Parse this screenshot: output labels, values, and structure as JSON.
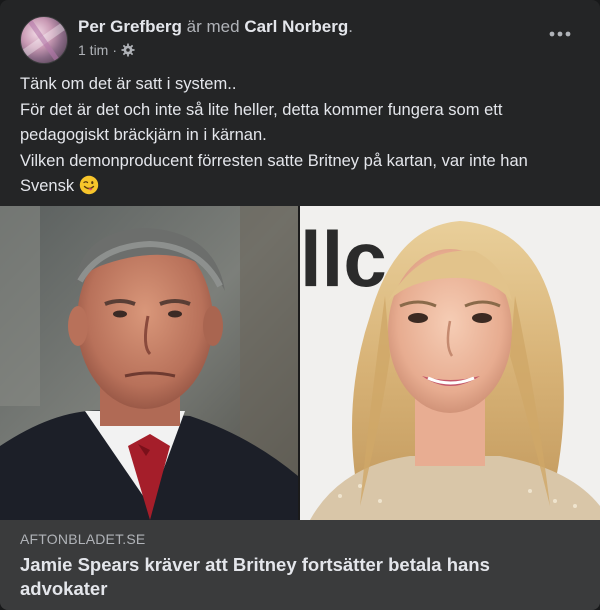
{
  "post": {
    "author": "Per Grefberg",
    "with_text": "är med",
    "tagged": "Carl Norberg",
    "tagged_suffix": ".",
    "time": "1 tim",
    "time_separator": "·",
    "privacy_icon": "gear-icon",
    "more_icon": "more-dots-icon",
    "text_lines": [
      "Tänk om det är satt i system..",
      "För det är det och inte så lite heller, detta kommer fungera som ett pedagogiskt bräckjärn in i kärnan.",
      "Vilken demonproducent förresten satte Britney på kartan, var inte han Svensk"
    ],
    "emoji": "winking-face-tongue-emoji"
  },
  "link": {
    "domain": "AFTONBLADET.SE",
    "title": "Jamie Spears kräver att Britney fortsätter betala hans advokater",
    "image_backdrop_text": "llc"
  },
  "colors": {
    "card_bg": "#242526",
    "link_bg": "#3a3b3c",
    "text_primary": "#e4e6eb",
    "text_secondary": "#b0b3b8"
  }
}
